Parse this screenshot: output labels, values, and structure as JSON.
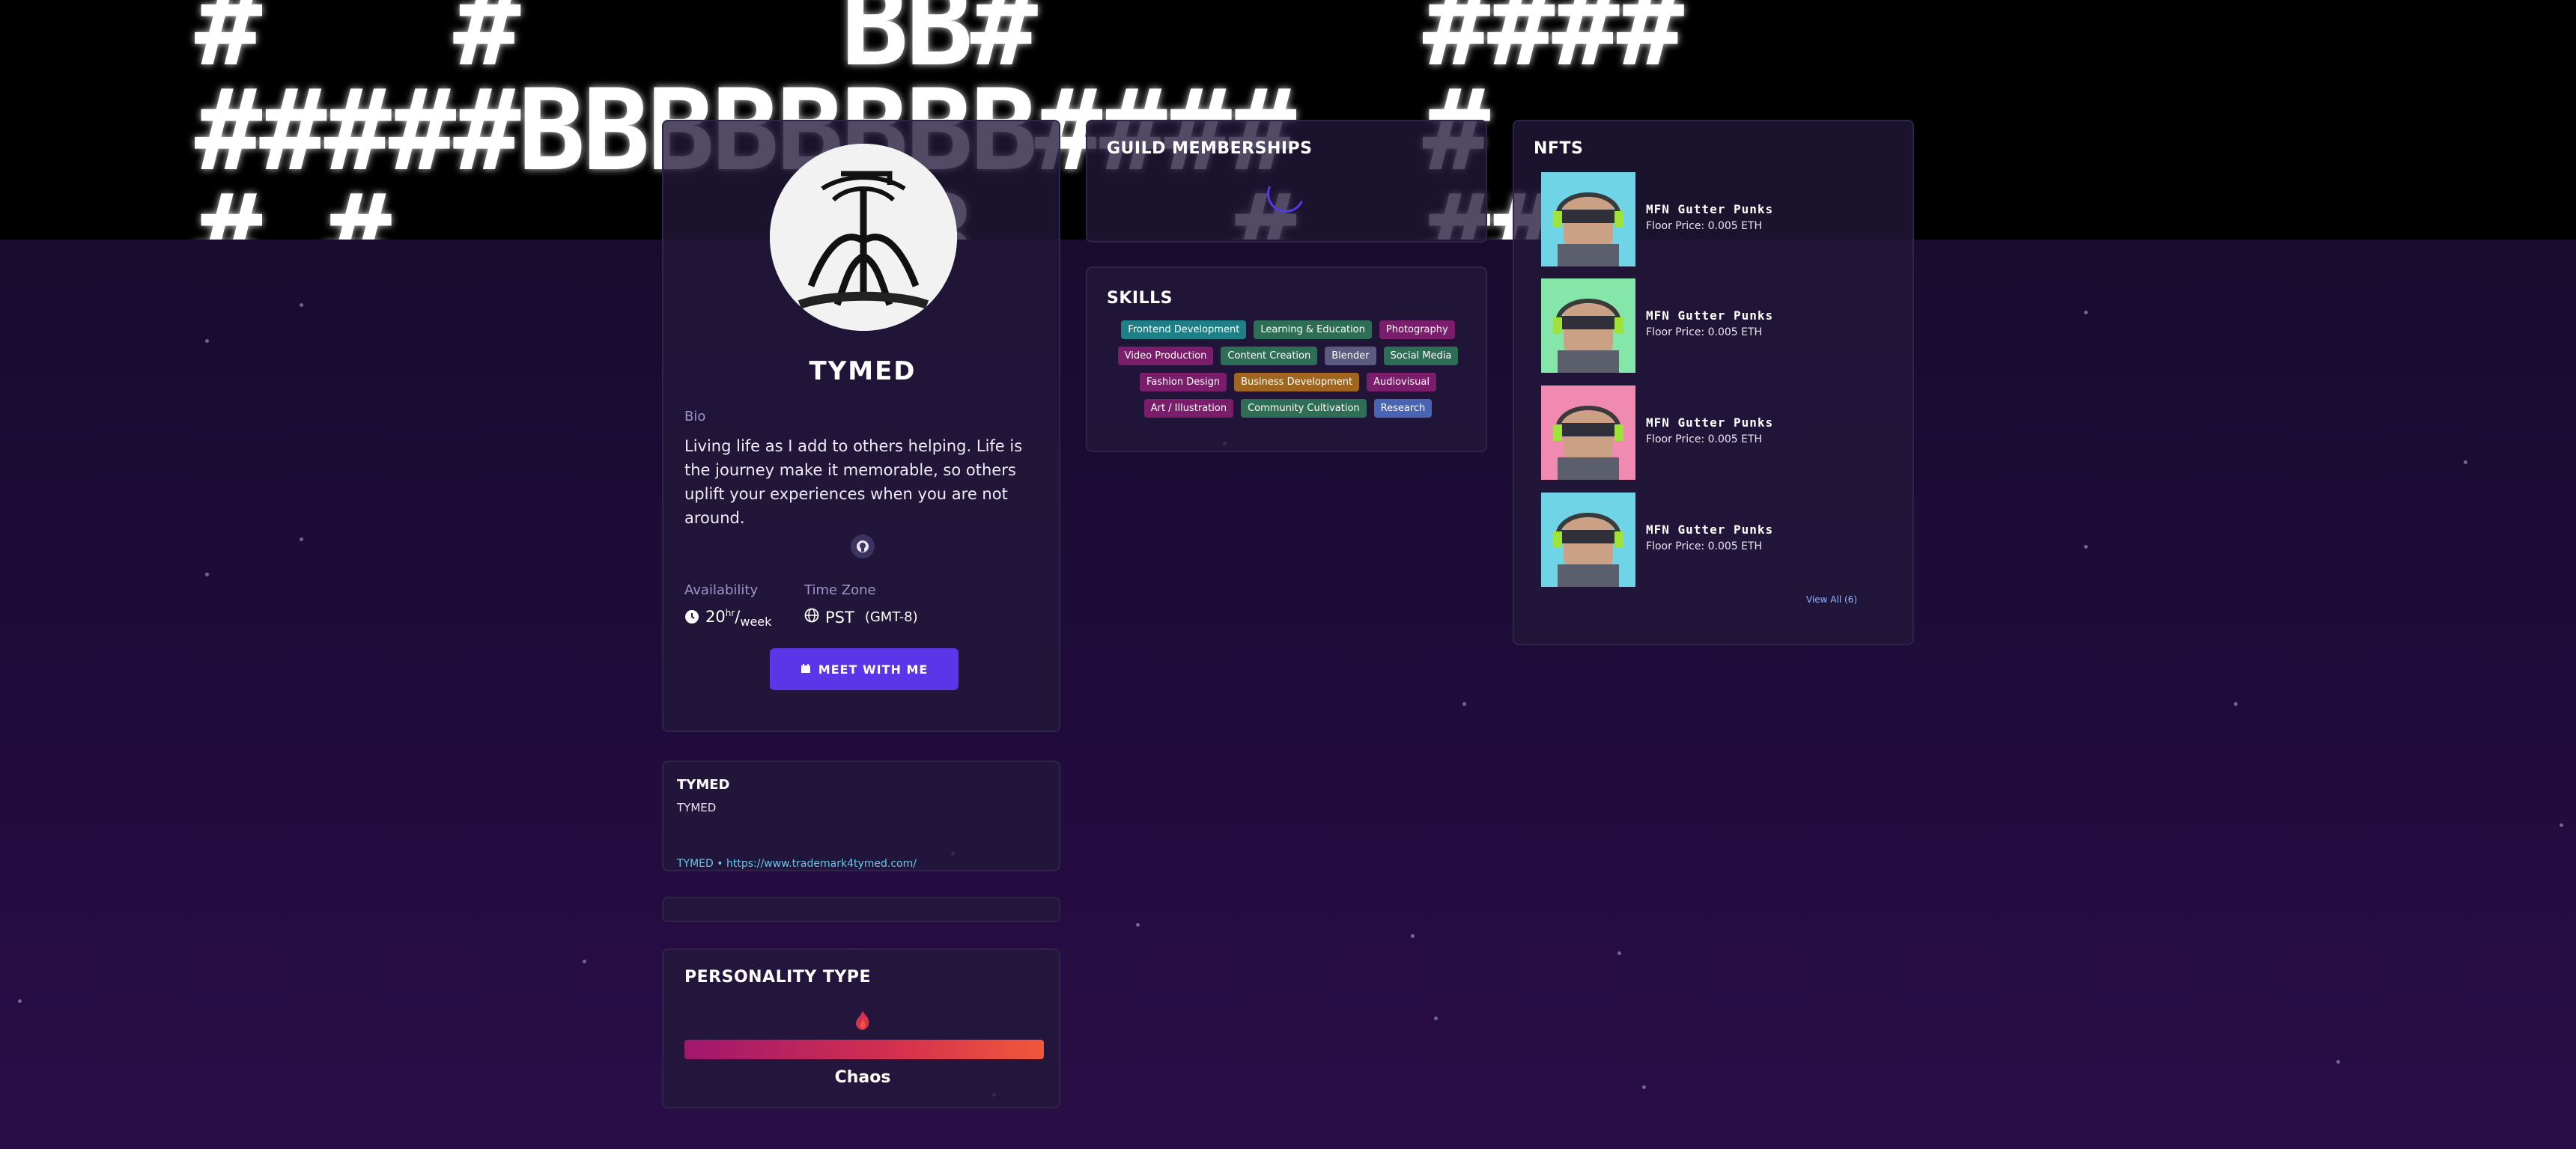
{
  "header_glyphs": {
    "row1": "#   #     BB#      ####",
    "row2": "#####BBBBBBBB####  #",
    "row3": "# #       BB    #  ##"
  },
  "profile": {
    "username": "TYMED",
    "bio_label": "Bio",
    "bio_text": "Living life as I add to others helping. Life is the journey make it memorable, so others uplift your experiences when you are not around.",
    "availability_label": "Availability",
    "availability_value": "20",
    "availability_unit_top": "hr",
    "availability_unit_bottom": "week",
    "timezone_label": "Time Zone",
    "timezone_value": "PST",
    "timezone_offset": "(GMT-8)",
    "meet_button": "MEET WITH ME",
    "icons": {
      "github": "github-icon",
      "clock": "clock-icon",
      "globe": "globe-icon",
      "calendar": "calendar-icon"
    }
  },
  "trademark": {
    "title": "TYMED",
    "subtitle": "TYMED",
    "link_prefix": "TYMED •",
    "link_url": "https://www.trademark4tymed.com/"
  },
  "personality": {
    "title": "PERSONALITY TYPE",
    "value_label": "Chaos",
    "icon": "flame-icon"
  },
  "guild": {
    "title": "GUILD MEMBERSHIPS",
    "state": "loading"
  },
  "skills": {
    "title": "SKILLS",
    "items": [
      {
        "label": "Frontend Development",
        "color": "#1f7f86"
      },
      {
        "label": "Learning & Education",
        "color": "#2e6e56"
      },
      {
        "label": "Photography",
        "color": "#7a1d6b"
      },
      {
        "label": "Video Production",
        "color": "#7a1d6b"
      },
      {
        "label": "Content Creation",
        "color": "#2e6e56"
      },
      {
        "label": "Blender",
        "color": "#5b5a80"
      },
      {
        "label": "Social Media",
        "color": "#2e6e56"
      },
      {
        "label": "Fashion Design",
        "color": "#7a1d6b"
      },
      {
        "label": "Business Development",
        "color": "#a0651f"
      },
      {
        "label": "Audiovisual",
        "color": "#7a1d6b"
      },
      {
        "label": "Art / Illustration",
        "color": "#7a1d6b"
      },
      {
        "label": "Community Cultivation",
        "color": "#2e6e56"
      },
      {
        "label": "Research",
        "color": "#4a64b4"
      }
    ]
  },
  "nfts": {
    "title": "NFTs",
    "items": [
      {
        "name": "MFN Gutter Punks",
        "price": "Floor Price: 0.005 ETH",
        "bg": "#6ed4e6"
      },
      {
        "name": "MFN Gutter Punks",
        "price": "Floor Price: 0.005 ETH",
        "bg": "#84e6a8"
      },
      {
        "name": "MFN Gutter Punks",
        "price": "Floor Price: 0.005 ETH",
        "bg": "#f08ab0"
      },
      {
        "name": "MFN Gutter Punks",
        "price": "Floor Price: 0.005 ETH",
        "bg": "#6ed4e6"
      }
    ],
    "view_all": "View All (6)"
  }
}
